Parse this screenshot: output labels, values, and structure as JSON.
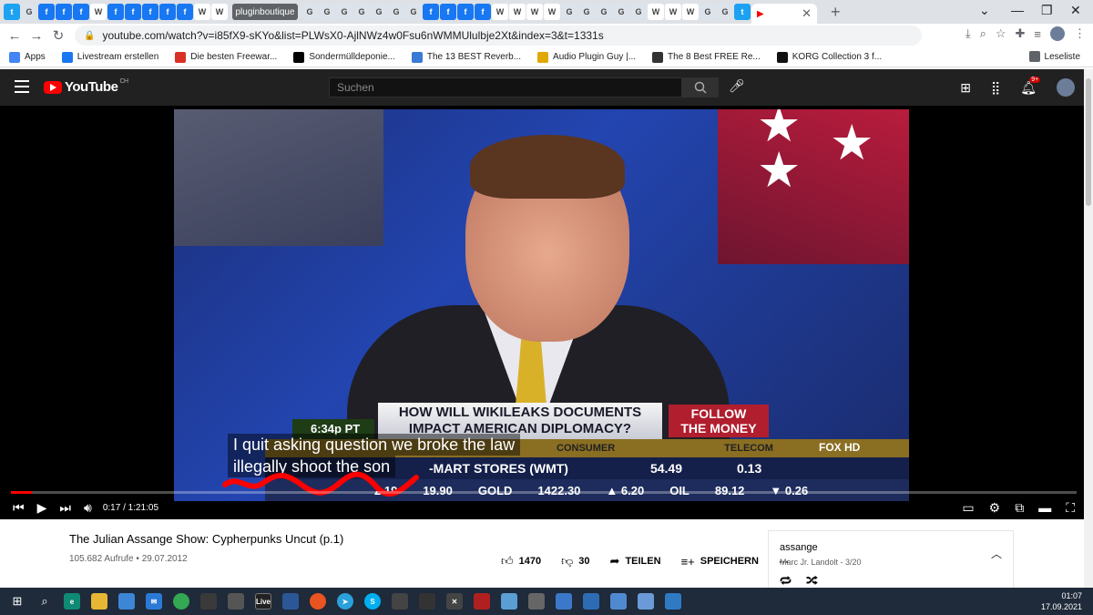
{
  "browser": {
    "tabs_left": [
      "t",
      "G",
      "f",
      "f",
      "f",
      "W",
      "f",
      "f",
      "f",
      "f",
      "f",
      "W",
      "W"
    ],
    "active_tab": "pluginboutique",
    "tabs_right": [
      "G",
      "G",
      "G",
      "G",
      "G",
      "G",
      "G",
      "f",
      "f",
      "f",
      "f",
      "W",
      "W",
      "W",
      "W",
      "G",
      "G",
      "G",
      "G",
      "G",
      "W",
      "W",
      "W",
      "G",
      "G",
      "t"
    ],
    "tab_colors": {
      "t": "#1da1f2",
      "G": "#dde3ea",
      "f": "#1877f2",
      "W": "#ffffff"
    },
    "url": "youtube.com/watch?v=i85fX9-sKYo&list=PLWsX0-AjlNWz4w0Fsu6nWMMUlulbje2Xt&index=3&t=1331s",
    "bookmarks": [
      {
        "icon": "apps-grid-icon",
        "label": "Apps",
        "color": "#4285f4"
      },
      {
        "icon": "facebook-icon",
        "label": "Livestream erstellen",
        "color": "#1877f2"
      },
      {
        "icon": "star-icon",
        "label": "Die besten Freewar...",
        "color": "#d93025"
      },
      {
        "icon": "wikipedia-icon",
        "label": "Sondermülldeponie...",
        "color": "#000000"
      },
      {
        "icon": "m-icon",
        "label": "The 13 BEST Reverb...",
        "color": "#3a7bd5"
      },
      {
        "icon": "audio-guy-icon",
        "label": "Audio Plugin Guy |...",
        "color": "#e0a800"
      },
      {
        "icon": "moon-icon",
        "label": "The 8 Best FREE Re...",
        "color": "#333333"
      },
      {
        "icon": "korg-icon",
        "label": "KORG Collection 3 f...",
        "color": "#111111"
      }
    ],
    "reading_list": "Leseliste"
  },
  "youtube": {
    "logo_text": "YouTube",
    "region": "CH",
    "search_placeholder": "Suchen",
    "notifications": "9+"
  },
  "video": {
    "ticker_question_1": "HOW WILL WIKILEAKS DOCUMENTS",
    "ticker_question_2": "IMPACT AMERICAN DIPLOMACY?",
    "follow_1": "FOLLOW",
    "follow_2": "THE MONEY",
    "clock": "6:34p PT",
    "consumer": "CONSUMER",
    "telecom": "TELECOM",
    "network": "FOX HD",
    "stock_name": "-MART STORES (WMT)",
    "stock_price": "54.49",
    "stock_change": "0.13",
    "bottom_ticker": [
      "2.19",
      "19.90",
      "GOLD",
      "1422.30",
      "▲ 6.20",
      "OIL",
      "89.12",
      "▼ 0.26"
    ],
    "caption_line_1": "I quit asking question we broke the law",
    "caption_line_2": "illegally shoot the son",
    "time_current": "0:17",
    "time_total": "1:21:05",
    "progress_fraction": 0.02
  },
  "info": {
    "title": "The Julian Assange Show: Cypherpunks Uncut (p.1)",
    "views": "105.682 Aufrufe",
    "date": "29.07.2012",
    "likes": "1470",
    "dislikes": "30",
    "share": "TEILEN",
    "save": "SPEICHERN"
  },
  "playlist": {
    "title": "assange",
    "owner": "Marc Jr. Landolt",
    "position": "3/20"
  },
  "taskbar": {
    "time": "01:07",
    "date": "17.09.2021"
  }
}
